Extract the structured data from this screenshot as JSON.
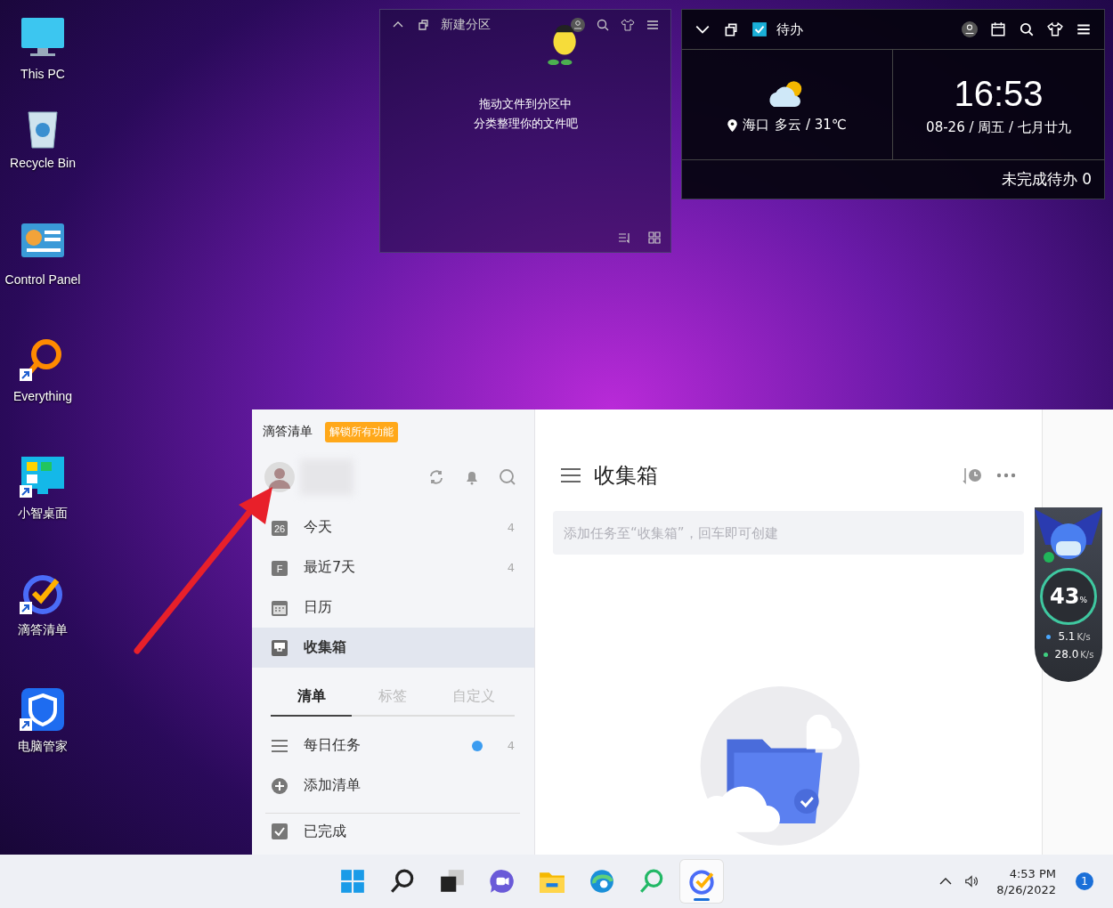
{
  "desktop_icons": [
    {
      "label": "This PC",
      "kind": "pc",
      "shortcut": false
    },
    {
      "label": "Recycle Bin",
      "kind": "bin",
      "shortcut": false
    },
    {
      "label": "Control Panel",
      "kind": "control",
      "shortcut": false
    },
    {
      "label": "Everything",
      "kind": "everything",
      "shortcut": true
    },
    {
      "label": "小智桌面",
      "kind": "xiaozhi",
      "shortcut": true
    },
    {
      "label": "滴答清单",
      "kind": "dida",
      "shortcut": true
    },
    {
      "label": "电脑管家",
      "kind": "guard",
      "shortcut": true
    }
  ],
  "fence_widget": {
    "title": "新建分区",
    "message": [
      "拖动文件到分区中",
      "分类整理你的文件吧"
    ]
  },
  "todo_widget": {
    "title": "待办",
    "city": "海口",
    "weather": "多云 / 31℃",
    "time": "16:53",
    "date": "08-26 / 周五 / 七月廿九",
    "footer": "未完成待办 0"
  },
  "app": {
    "title": "滴答清单",
    "unlock_badge": "解锁所有功能",
    "nav": [
      {
        "label": "今天",
        "kind": "today",
        "icon_label": "26",
        "count": "4",
        "selected": false
      },
      {
        "label": "最近7天",
        "kind": "week",
        "icon_label": "F",
        "count": "4",
        "selected": false
      },
      {
        "label": "日历",
        "kind": "calendar",
        "selected": false
      },
      {
        "label": "收集箱",
        "kind": "inbox",
        "selected": true
      }
    ],
    "tabs": [
      {
        "label": "清单",
        "selected": true
      },
      {
        "label": "标签",
        "selected": false
      },
      {
        "label": "自定义",
        "selected": false
      }
    ],
    "lists": [
      {
        "label": "每日任务",
        "kind": "list",
        "color": "#3b9cf0",
        "count": "4"
      },
      {
        "label": "添加清单",
        "kind": "add"
      }
    ],
    "completed": "已完成",
    "main_title": "收集箱",
    "task_input": {
      "placeholder": "添加任务至“收集箱”，回车即可创建"
    }
  },
  "speed_widget": {
    "percent": "43",
    "percent_unit": "%",
    "upload": "5.1",
    "upload_unit": "K/s",
    "download": "28.0",
    "download_unit": "K/s"
  },
  "taskbar": {
    "apps": [
      {
        "kind": "start",
        "selected": false
      },
      {
        "kind": "search",
        "selected": false
      },
      {
        "kind": "taskview",
        "selected": false
      },
      {
        "kind": "chat",
        "selected": false
      },
      {
        "kind": "explorer",
        "selected": false
      },
      {
        "kind": "edge",
        "selected": false
      },
      {
        "kind": "finder",
        "selected": false
      },
      {
        "kind": "dida",
        "selected": true
      }
    ],
    "time": "4:53 PM",
    "date": "8/26/2022",
    "notifications": "1"
  }
}
